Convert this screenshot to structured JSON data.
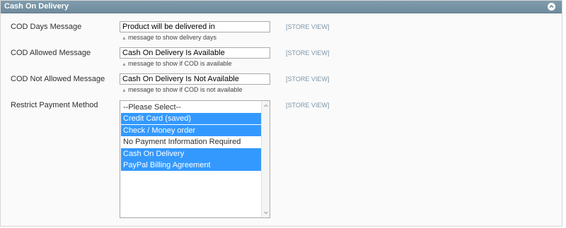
{
  "section": {
    "title": "Cash On Delivery",
    "collapse_icon": "chevron-up-circle-icon"
  },
  "fields": [
    {
      "label": "COD Days Message",
      "value": "Product will be delivered in",
      "note": "message to show delivery days",
      "scope": "[STORE VIEW]"
    },
    {
      "label": "COD Allowed Message",
      "value": "Cash On Delivery Is Available",
      "note": "message to show if COD is available",
      "scope": "[STORE VIEW]"
    },
    {
      "label": "COD Not Allowed Message",
      "value": "Cash On Delivery Is Not Available",
      "note": "message to show if COD is not available",
      "scope": "[STORE VIEW]"
    }
  ],
  "restrict": {
    "label": "Restrict Payment Method",
    "scope": "[STORE VIEW]",
    "options": [
      {
        "label": "--Please Select--",
        "selected": false
      },
      {
        "label": "Credit Card (saved)",
        "selected": true
      },
      {
        "label": "Check / Money order",
        "selected": true
      },
      {
        "label": "No Payment Information Required",
        "selected": false
      },
      {
        "label": "Cash On Delivery",
        "selected": true
      },
      {
        "label": "PayPal Billing Agreement",
        "selected": true
      }
    ],
    "scroll_up_icon": "scroll-up-arrow-icon",
    "scroll_down_icon": "scroll-down-arrow-icon"
  },
  "colors": {
    "header_bg": "#6f8c9e",
    "selected_bg": "#3399ff",
    "scope_text": "#7d95a7"
  }
}
